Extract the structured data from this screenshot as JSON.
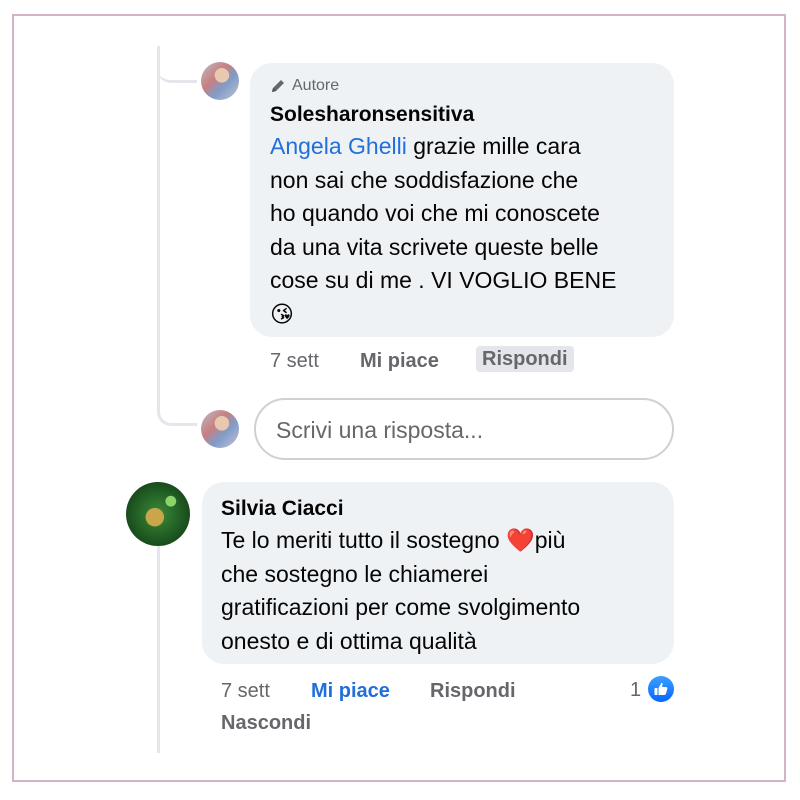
{
  "reply": {
    "badge_label": "Autore",
    "author_name": "Solesharonsensitiva",
    "mention": "Angela Ghelli",
    "text": " grazie mille cara\nnon sai che soddisfazione  che\nho quando voi che mi conoscete\nda una vita scrivete  queste belle\ncose su di me . VI VOGLIO BENE\n😘",
    "time": "7 sett",
    "like_label": "Mi piace",
    "reply_label": "Rispondi"
  },
  "reply_input": {
    "placeholder": "Scrivi una risposta..."
  },
  "comment": {
    "author_name": "Silvia Ciacci",
    "text_before_emoji": "Te lo meriti tutto il sostegno ",
    "emoji": "❤️",
    "text_after_emoji": "più\nche sostegno le chiamerei\ngratificazioni per come svolgimento\nonesto e di ottima qualità",
    "time": "7 sett",
    "like_label": "Mi piace",
    "reply_label": "Rispondi",
    "hide_label": "Nascondi",
    "like_count": "1"
  },
  "colors": {
    "mention_blue": "#216fdb",
    "bubble_bg": "#eff2f5",
    "secondary_text": "#65676b",
    "frame_border": "#d3b3c6"
  },
  "icons": {
    "author_badge": "pencil-icon",
    "reaction": "thumbs-up-icon"
  }
}
